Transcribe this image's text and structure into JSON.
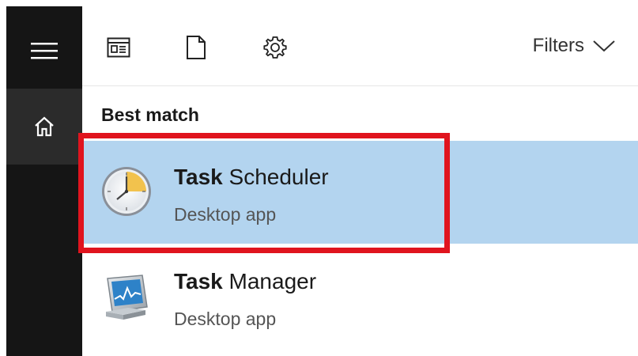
{
  "sidebar": {
    "menu_icon": "hamburger-menu-icon",
    "home_icon": "home-icon"
  },
  "toolbar": {
    "apps_icon": "apps-window-icon",
    "documents_icon": "document-icon",
    "settings_icon": "gear-icon",
    "filters_label": "Filters",
    "filters_icon": "chevron-down-icon"
  },
  "results": {
    "section_title": "Best match",
    "items": [
      {
        "name_bold": "Task",
        "name_rest": " Scheduler",
        "type": "Desktop app",
        "icon": "clock-icon",
        "selected": true
      },
      {
        "name_bold": "Task",
        "name_rest": " Manager",
        "type": "Desktop app",
        "icon": "task-manager-icon",
        "selected": false
      }
    ]
  },
  "colors": {
    "sidebar_bg": "#151515",
    "home_bg": "#2b2b2b",
    "selected_bg": "#b3d4ef",
    "highlight_border": "#e0141e"
  }
}
